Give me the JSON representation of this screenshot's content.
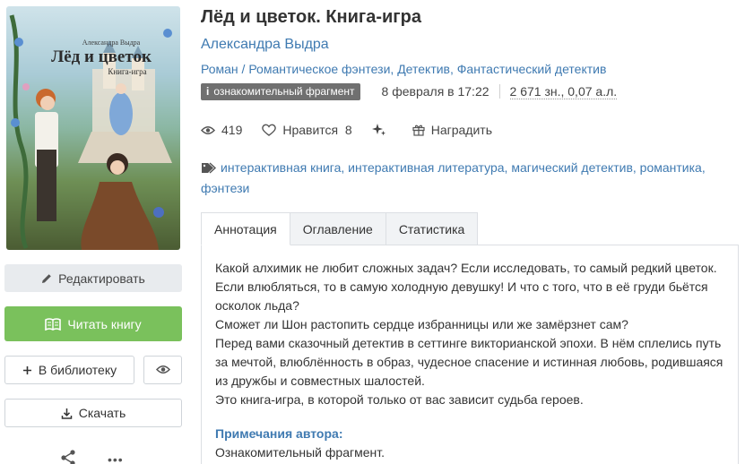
{
  "cover": {
    "author": "Александра Выдра",
    "title": "Лёд и цветок",
    "subtitle": "Книга-игра"
  },
  "book": {
    "title": "Лёд и цветок. Книга-игра",
    "author": "Александра Выдра",
    "genres": [
      "Роман",
      "Романтическое фэнтези",
      "Детектив",
      "Фантастический детектив"
    ]
  },
  "meta": {
    "badge_icon": "i",
    "badge": "ознакомительный фрагмент",
    "date": "8 февраля в 17:22",
    "size": "2 671 зн., 0,07 а.л."
  },
  "stats": {
    "views": "419",
    "likes_label": "Нравится",
    "likes": "8",
    "reward_label": "Наградить"
  },
  "tags": [
    "интерактивная книга",
    "интерактивная литература",
    "магический детектив",
    "романтика",
    "фэнтези"
  ],
  "buttons": {
    "edit": "Редактировать",
    "read": "Читать книгу",
    "library": "В библиотеку",
    "download": "Скачать",
    "more": "•••"
  },
  "tabs": [
    {
      "label": "Аннотация",
      "active": true
    },
    {
      "label": "Оглавление",
      "active": false
    },
    {
      "label": "Статистика",
      "active": false
    }
  ],
  "annotation": {
    "paragraphs": [
      "Какой алхимик не любит сложных задач? Если исследовать, то самый редкий цветок. Если влюбляться, то в самую холодную девушку! И что с того, что в её груди бьётся осколок льда?",
      "Сможет ли Шон растопить сердце избранницы или же замёрзнет сам?",
      "Перед вами сказочный детектив в сеттинге викторианской эпохи. В нём сплелись путь за мечтой, влюблённость в образ, чудесное спасение и истинная любовь, родившаяся из дружбы и совместных шалостей.",
      "Это книга-игра, в которой только от вас зависит судьба героев."
    ],
    "notes_title": "Примечания автора:",
    "notes_text": "Ознакомительный фрагмент."
  },
  "colors": {
    "link": "#3f7ab1",
    "read_button": "#7ac15c",
    "badge": "#707070"
  }
}
